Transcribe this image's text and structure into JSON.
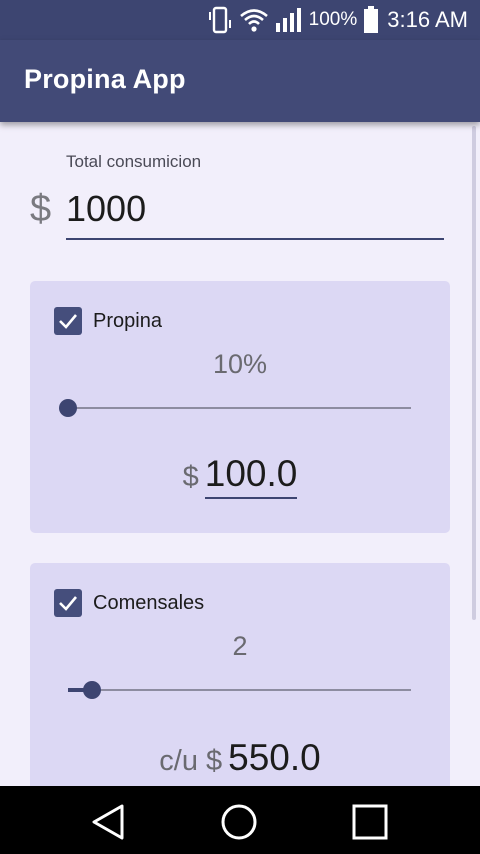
{
  "status_bar": {
    "battery_percent": "100%",
    "time": "3:16 AM",
    "icons": [
      "vibrate-icon",
      "wifi-icon",
      "signal-icon",
      "battery-icon"
    ]
  },
  "app_bar": {
    "title": "Propina App"
  },
  "total": {
    "label": "Total consumicion",
    "currency": "$",
    "value": "1000"
  },
  "tip_card": {
    "checkbox_label": "Propina",
    "checked": true,
    "percent_display": "10%",
    "slider_fraction": 0.0,
    "amount_prefix": "$",
    "amount_value": "100.0"
  },
  "diners_card": {
    "checkbox_label": "Comensales",
    "checked": true,
    "count_display": "2",
    "slider_fraction": 0.07,
    "amount_prefix": "c/u $",
    "amount_value": "550.0"
  },
  "navigation": {
    "back_icon": "back-triangle-icon",
    "home_icon": "home-circle-icon",
    "recent_icon": "recent-apps-square-icon"
  },
  "colors": {
    "primary": "#424a77",
    "status_bar": "#3d4571",
    "card_background": "#dcd8f4",
    "page_background": "#f2effb"
  }
}
